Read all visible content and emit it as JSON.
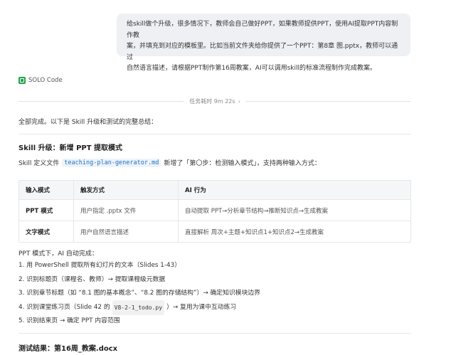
{
  "user_message": {
    "lines": [
      "给skill做个升级，很多情况下，教师会自己做好PPT，如果教师提供PPT，使用AI提取PPT内容制作教",
      "案，并填充到对应的模板里。比如当前文件夹给你提供了一个PPT：第8章 图.pptx，教师可以通过",
      "自然语言描述，请根据PPT制作第16周教案，AI可以调用skill的标准流程制作完成教案。"
    ]
  },
  "agent": {
    "name": "SOLO Code"
  },
  "task_time": {
    "label": "任务耗时 9m 22s",
    "chevron": "›"
  },
  "summary": "全部完成。以下是 Skill 升级和测试的完整总结：",
  "section1": {
    "title": "Skill 升级：新增 PPT 提取模式",
    "desc_prefix": "Skill 定义文件",
    "desc_code": "teaching-plan-generator.md",
    "desc_suffix": "新增了「第〇步：检测输入模式」，支持两种输入方式："
  },
  "table": {
    "headers": [
      "输入模式",
      "触发方式",
      "AI 行为"
    ],
    "rows": [
      [
        "PPT 模式",
        "用户指定 .pptx 文件",
        "自动提取 PPT→分析章节结构→推断知识点→生成教案"
      ],
      [
        "文字模式",
        "用户自然语言描述",
        "直接解析 周次+主题+知识点1+知识点2→生成教案"
      ]
    ]
  },
  "ppt_mode_intro": "PPT 模式下，AI 自动完成：",
  "steps": [
    {
      "text": "1. 用 PowerShell 提取所有幻灯片的文本（Slides 1-43）"
    },
    {
      "text": "2. 识别标题页（课程名、教师）→ 提取课程级元数据"
    },
    {
      "text": "3. 识别章节标题（如 “8.1 图的基本概念”、“8.2 图的存储结构”）→ 确定知识模块边界"
    },
    {
      "pre": "4. 识别课堂练习页（Slide 42 的",
      "code": "V8-2-1_todo.py",
      "post": "）→ 复用为课中互动练习"
    },
    {
      "text": "5. 识别结束页 → 确定 PPT 内容范围"
    }
  ],
  "section2": {
    "title": "测试结果：第16周_教案.docx"
  }
}
